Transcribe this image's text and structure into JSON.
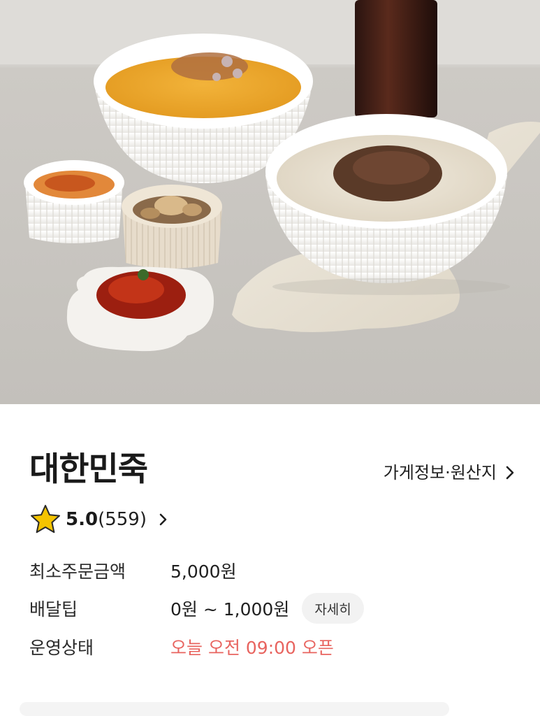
{
  "store": {
    "name": "대한민죽",
    "info_link_label": "가게정보·원산지"
  },
  "rating": {
    "value": "5.0",
    "count": "(559)"
  },
  "details": {
    "min_order_label": "최소주문금액",
    "min_order_value": "5,000원",
    "delivery_tip_label": "배달팁",
    "delivery_tip_value": "0원 ~ 1,000원",
    "delivery_tip_button": "자세히",
    "status_label": "운영상태",
    "status_value": "오늘 오전 09:00 오픈"
  },
  "colors": {
    "status_accent": "#e8645f",
    "star": "#f5c400"
  }
}
